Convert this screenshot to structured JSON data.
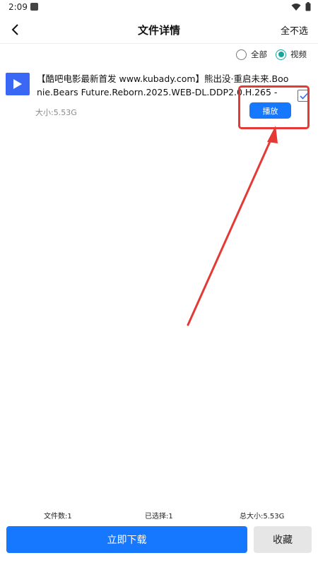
{
  "status_bar": {
    "time": "2:09",
    "icons": [
      "app-notification-icon",
      "wifi-icon",
      "battery-icon"
    ]
  },
  "header": {
    "title": "文件详情",
    "deselect_all_label": "全不选",
    "back_icon": "back-arrow-icon"
  },
  "filter": {
    "options": [
      {
        "label": "全部",
        "selected": false
      },
      {
        "label": "视频",
        "selected": true
      }
    ],
    "accent_color": "#19a59b"
  },
  "files": [
    {
      "name": "【酷吧电影最新首发 www.kubady.com】熊出没·重启未来.Boonie.Bears Future.Reborn.2025.WEB-DL.DDP2.0.H.265 -",
      "size_label": "大小:5.53G",
      "checked": true,
      "play_label": "播放",
      "icon": "play-icon"
    }
  ],
  "summary": {
    "file_count": "文件数:1",
    "selected_count": "已选择:1",
    "total_size": "总大小:5.53G"
  },
  "actions": {
    "download_label": "立即下载",
    "favorite_label": "收藏"
  },
  "colors": {
    "primary": "#1677ff",
    "thumb": "#3b67f5",
    "annotation": "#e53935"
  }
}
